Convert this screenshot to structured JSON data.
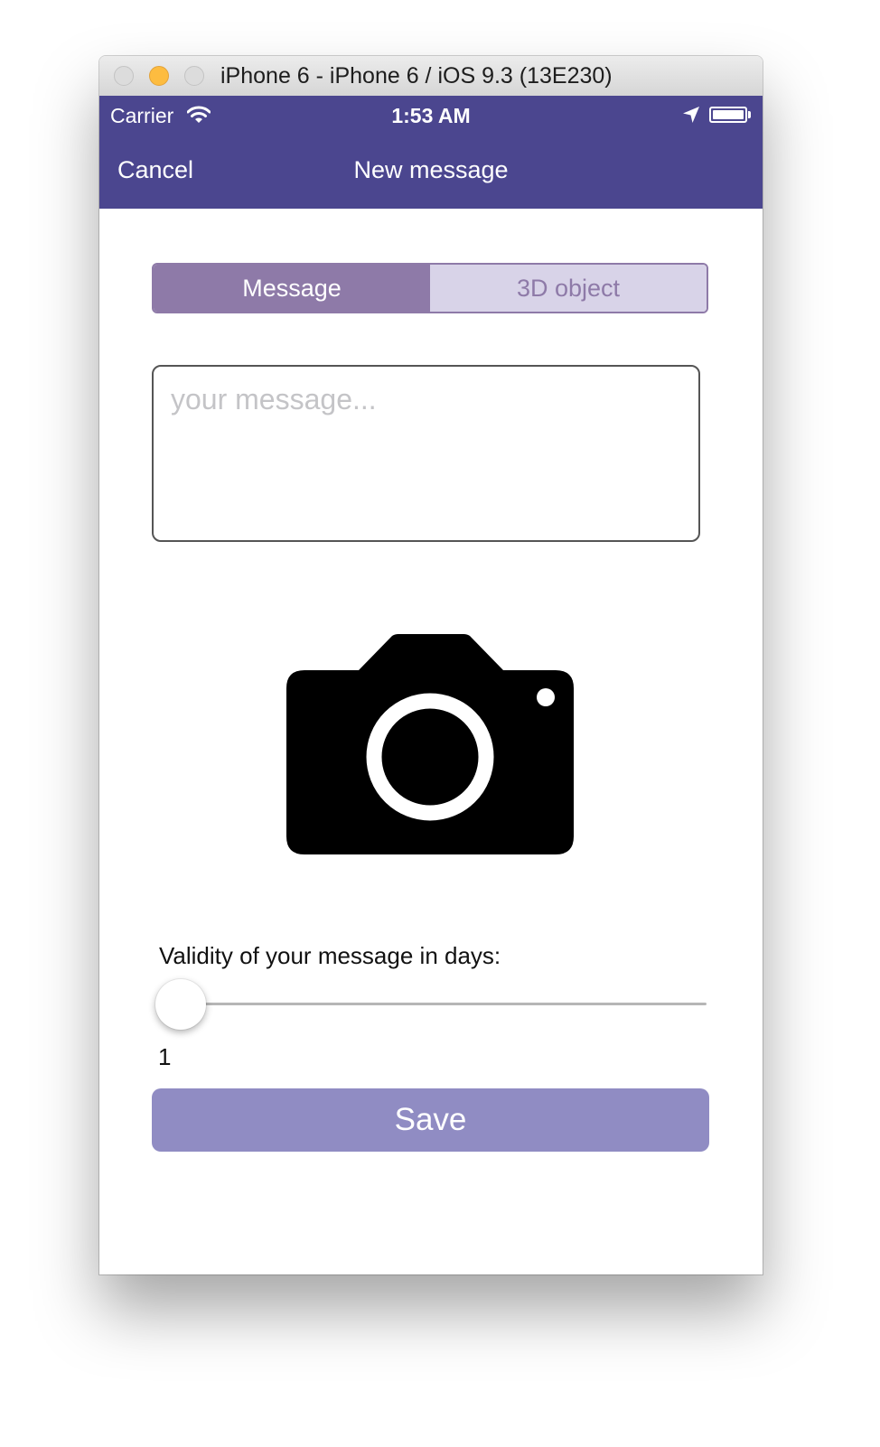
{
  "window": {
    "title": "iPhone 6 - iPhone 6 / iOS 9.3 (13E230)"
  },
  "status_bar": {
    "carrier": "Carrier",
    "time": "1:53 AM"
  },
  "nav": {
    "cancel_label": "Cancel",
    "title": "New message",
    "background": "#4b468f"
  },
  "segment": {
    "options": [
      "Message",
      "3D object"
    ],
    "selected": "Message",
    "accent": "#8e7aa8"
  },
  "message": {
    "placeholder": "your message...",
    "value": ""
  },
  "camera": {
    "icon": "camera-icon"
  },
  "validity": {
    "label": "Validity of your message in days:",
    "value": "1",
    "slider_fraction": 0
  },
  "save": {
    "label": "Save",
    "color": "#908cc3"
  }
}
